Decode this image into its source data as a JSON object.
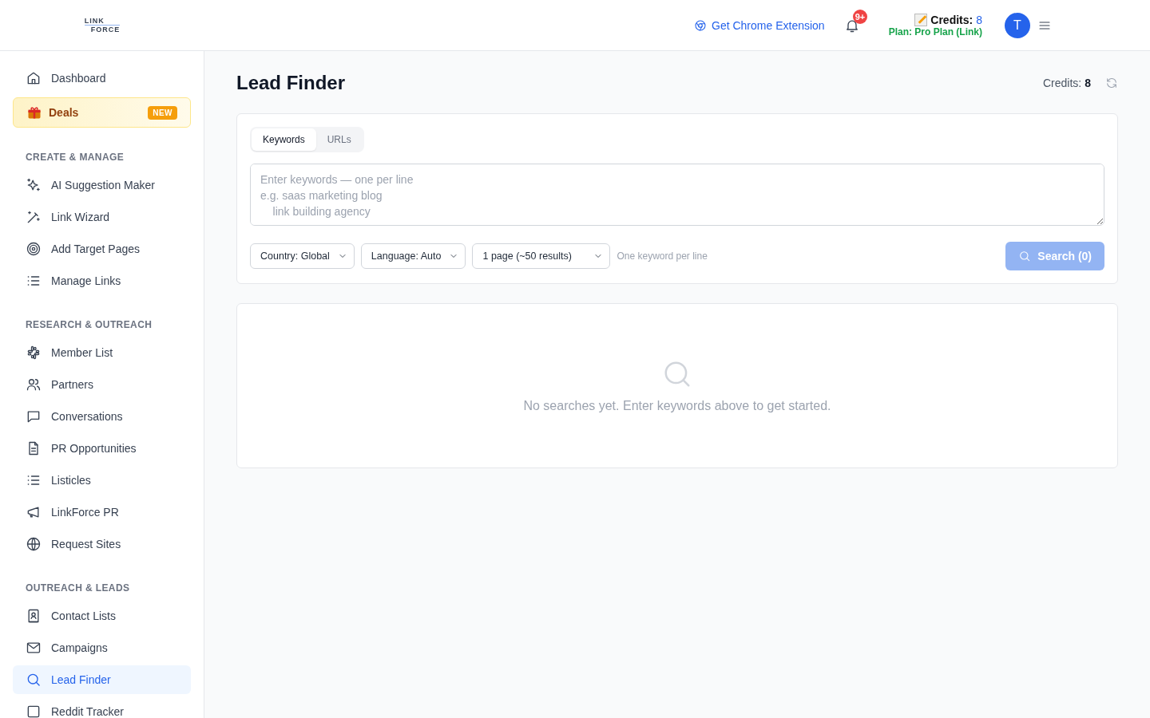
{
  "header": {
    "logo": {
      "top": "LINK",
      "bottom": "FORCE"
    },
    "extension_link": "Get Chrome Extension",
    "notifications_badge": "9+",
    "credits_label": "Credits:",
    "credits_value": "8",
    "plan": "Plan: Pro Plan (Link)",
    "avatar": "T"
  },
  "sidebar": {
    "top": [
      {
        "label": "Dashboard",
        "kind": "link",
        "selected": false
      },
      {
        "label": "Deals",
        "kind": "promo",
        "badge": "NEW",
        "selected": false
      }
    ],
    "sections": [
      {
        "title": "CREATE & MANAGE",
        "items": [
          {
            "label": "AI Suggestion Maker",
            "selected": false
          },
          {
            "label": "Link Wizard",
            "selected": false
          },
          {
            "label": "Add Target Pages",
            "selected": false
          },
          {
            "label": "Manage Links",
            "selected": false
          }
        ]
      },
      {
        "title": "RESEARCH & OUTREACH",
        "items": [
          {
            "label": "Member List",
            "selected": false
          },
          {
            "label": "Partners",
            "selected": false
          },
          {
            "label": "Conversations",
            "selected": false
          },
          {
            "label": "PR Opportunities",
            "selected": false
          },
          {
            "label": "Listicles",
            "selected": false
          },
          {
            "label": "LinkForce PR",
            "selected": false
          },
          {
            "label": "Request Sites",
            "selected": false
          }
        ]
      },
      {
        "title": "OUTREACH & LEADS",
        "items": [
          {
            "label": "Contact Lists",
            "selected": false
          },
          {
            "label": "Campaigns",
            "selected": false
          },
          {
            "label": "Lead Finder",
            "selected": true
          },
          {
            "label": "Reddit Tracker",
            "selected": false
          }
        ]
      }
    ]
  },
  "page": {
    "title": "Lead Finder",
    "credits_label": "Credits:",
    "credits_value": "8",
    "tabs": [
      {
        "label": "Keywords",
        "selected": true
      },
      {
        "label": "URLs",
        "selected": false
      }
    ],
    "keywords_field": {
      "placeholder": "Enter keywords — one per line\ne.g. saas marketing blog\n    link building agency"
    },
    "selects": [
      "Country: Global",
      "Language: Auto",
      "1 page (~50 results)"
    ],
    "hint": "One keyword per line",
    "search_button": {
      "label": "Search (0)",
      "disabled": true
    },
    "empty_state": "No searches yet. Enter keywords above to get started."
  }
}
